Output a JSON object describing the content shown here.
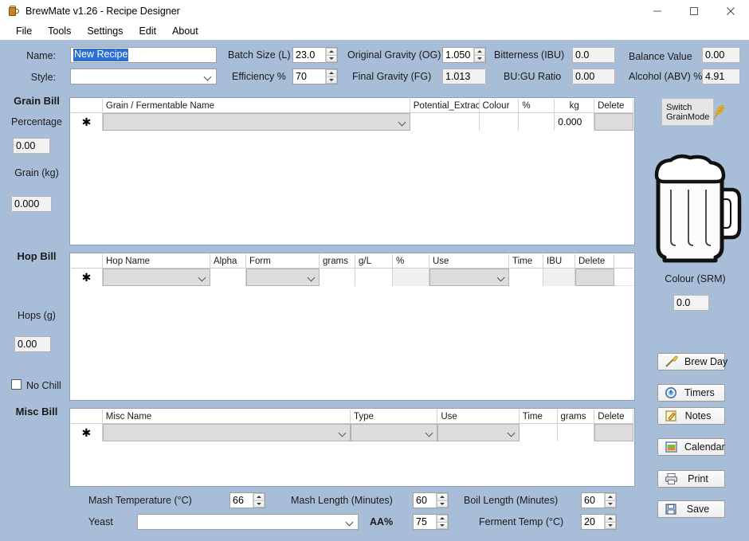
{
  "window": {
    "title": "BrewMate v1.26 - Recipe Designer",
    "app_icon": "beer-mug-icon",
    "minimize": "—",
    "maximize": "☐",
    "close": "✕"
  },
  "menubar": {
    "items": [
      "File",
      "Tools",
      "Settings",
      "Edit",
      "About"
    ]
  },
  "recipe_header": {
    "name_label": "Name:",
    "name_value": "New Recipe",
    "name_selected": true,
    "style_label": "Style:",
    "style_value": "",
    "batch_size_label": "Batch Size (L)",
    "batch_size_value": "23.0",
    "efficiency_label": "Efficiency %",
    "efficiency_value": "70",
    "og_label": "Original Gravity (OG)",
    "og_value": "1.050",
    "fg_label": "Final Gravity (FG)",
    "fg_value": "1.013",
    "ibu_label": "Bitterness (IBU)",
    "ibu_value": "0.0",
    "bugu_label": "BU:GU Ratio",
    "bugu_value": "0.00",
    "balance_label": "Balance Value",
    "balance_value": "0.00",
    "abv_label": "Alcohol (ABV) %",
    "abv_value": "4.91"
  },
  "grain_panel": {
    "title": "Grain Bill",
    "percentage_label": "Percentage",
    "percentage_value": "0.00",
    "grain_kg_label": "Grain (kg)",
    "grain_kg_value": "0.000"
  },
  "grain_grid": {
    "columns": [
      "Grain / Fermentable Name",
      "Potential_Extract",
      "Colour",
      "%",
      "kg",
      "Delete"
    ],
    "new_row_marker": "✱",
    "rows": [
      {
        "name": "",
        "potential_extract": "",
        "colour": "",
        "percent": "",
        "kg": "0.000",
        "delete": ""
      }
    ]
  },
  "hop_panel": {
    "title": "Hop Bill",
    "hops_g_label": "Hops (g)",
    "hops_g_value": "0.00",
    "no_chill_label": "No Chill",
    "no_chill_checked": false
  },
  "hop_grid": {
    "columns": [
      "Hop Name",
      "Alpha",
      "Form",
      "grams",
      "g/L",
      "%",
      "Use",
      "Time",
      "IBU",
      "Delete"
    ],
    "new_row_marker": "✱",
    "rows": [
      {
        "name": "",
        "alpha": "",
        "form": "",
        "grams": "",
        "g_per_l": "",
        "percent": "",
        "use": "",
        "time": "",
        "ibu": "",
        "delete": ""
      }
    ]
  },
  "misc_panel": {
    "title": "Misc Bill"
  },
  "misc_grid": {
    "columns": [
      "Misc Name",
      "Type",
      "Use",
      "Time",
      "grams",
      "Delete"
    ],
    "new_row_marker": "✱",
    "rows": [
      {
        "name": "",
        "type": "",
        "use": "",
        "time": "",
        "grams": "",
        "delete": ""
      }
    ]
  },
  "side_panel": {
    "switch_grain_mode_line1": "Switch",
    "switch_grain_mode_line2": "GrainMode",
    "switch_icon": "wheat-icon",
    "mug_icon": "beer-mug-illustration",
    "colour_srm_label": "Colour (SRM)",
    "colour_srm_value": "0.0",
    "buttons": [
      {
        "label": "Brew Day",
        "icon": "mash-paddle-icon"
      },
      {
        "label": "Timers",
        "icon": "clock-icon"
      },
      {
        "label": "Notes",
        "icon": "pencil-note-icon"
      },
      {
        "label": "Calendar",
        "icon": "calendar-icon"
      },
      {
        "label": "Print",
        "icon": "printer-icon"
      },
      {
        "label": "Save",
        "icon": "floppy-disk-icon"
      }
    ]
  },
  "bottom_controls": {
    "mash_temp_label": "Mash Temperature (°C)",
    "mash_temp_value": "66",
    "mash_length_label": "Mash Length (Minutes)",
    "mash_length_value": "60",
    "boil_length_label": "Boil Length (Minutes)",
    "boil_length_value": "60",
    "yeast_label": "Yeast",
    "yeast_value": "",
    "aa_label": "AA%",
    "aa_value": "75",
    "ferment_temp_label": "Ferment Temp (°C)",
    "ferment_temp_value": "20"
  },
  "colors": {
    "form_background": "#a8bed8",
    "titlebar": "#ffffff",
    "selection_blue": "#2b6fd4",
    "grid_background": "#ffffff",
    "button_face": "#eeeeee"
  }
}
